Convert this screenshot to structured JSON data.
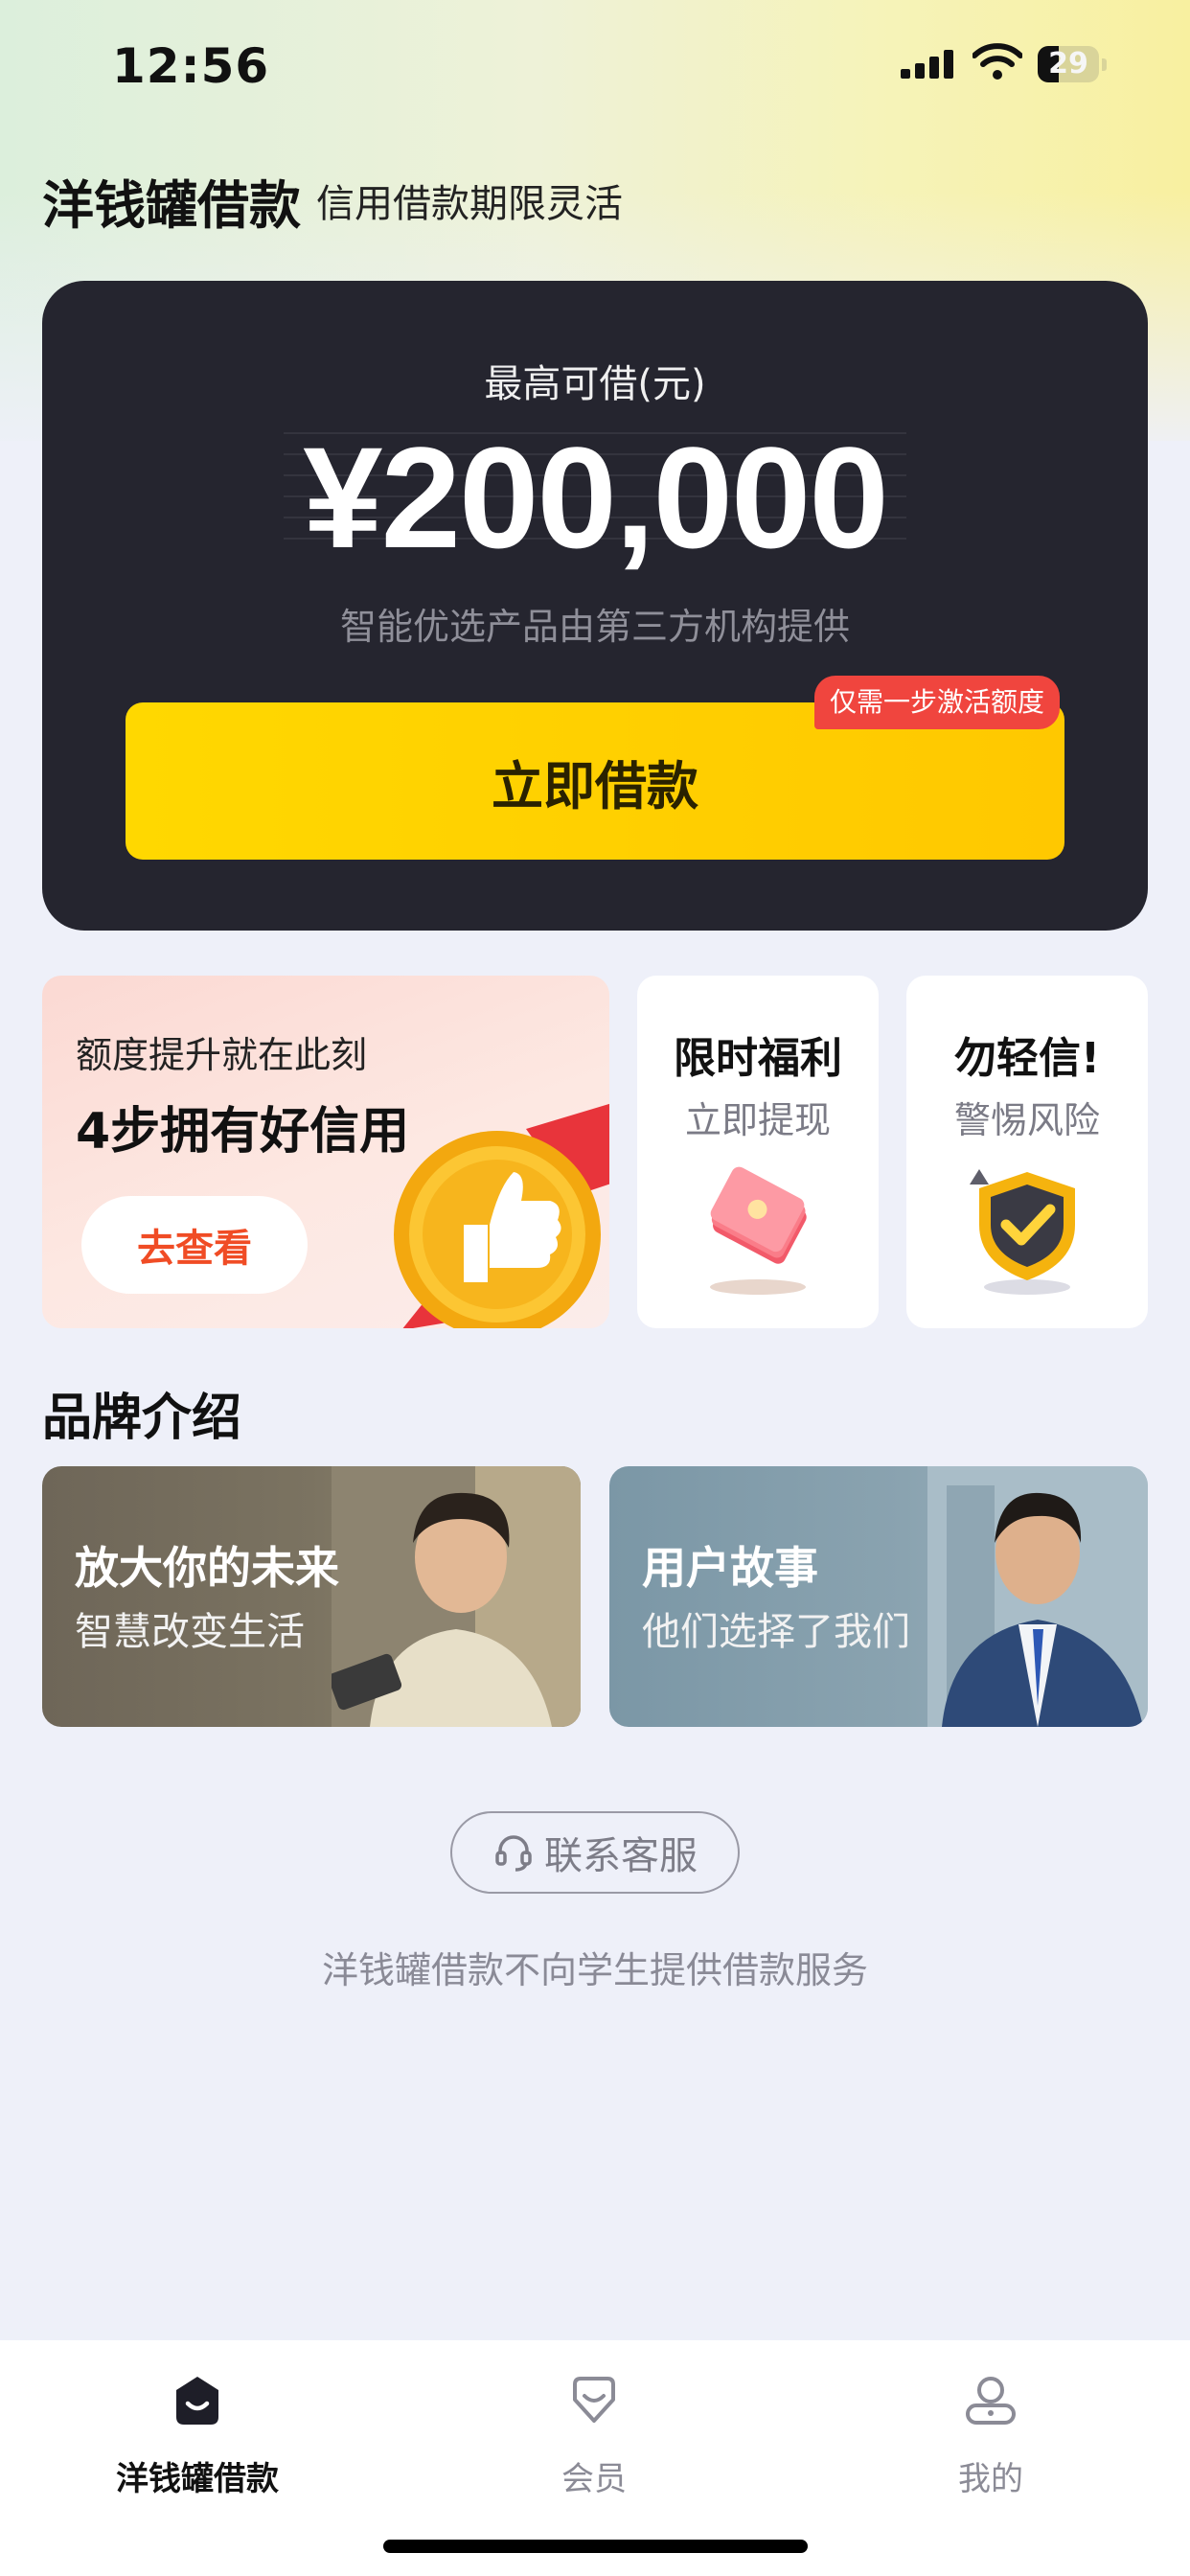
{
  "status_bar": {
    "time": "12:56",
    "battery": "29"
  },
  "header": {
    "title": "洋钱罐借款",
    "subtitle": "信用借款期限灵活"
  },
  "hero": {
    "label": "最高可借(元)",
    "amount": "¥200,000",
    "note": "智能优选产品由第三方机构提供",
    "button_label": "立即借款",
    "badge": "仅需一步激活额度"
  },
  "promo": {
    "small": "额度提升就在此刻",
    "big": "4步拥有好信用",
    "button_label": "去查看"
  },
  "mini_cards": [
    {
      "title": "限时福利",
      "subtitle": "立即提现",
      "icon": "red-envelope-icon"
    },
    {
      "title": "勿轻信!",
      "subtitle": "警惕风险",
      "icon": "shield-check-icon"
    }
  ],
  "brand": {
    "title": "品牌介绍",
    "banners": [
      {
        "title": "放大你的未来",
        "subtitle": "智慧改变生活"
      },
      {
        "title": "用户故事",
        "subtitle": "他们选择了我们"
      }
    ]
  },
  "service": {
    "label": "联系客服",
    "icon": "headset-icon"
  },
  "disclaimer": "洋钱罐借款不向学生提供借款服务",
  "tabs": [
    {
      "label": "洋钱罐借款",
      "icon": "home-smile-icon",
      "active": true
    },
    {
      "label": "会员",
      "icon": "member-icon",
      "active": false
    },
    {
      "label": "我的",
      "icon": "profile-icon",
      "active": false
    }
  ],
  "colors": {
    "accent": "#ffd200",
    "dark_card": "#25252f",
    "badge": "#f0453e",
    "promo_button_text": "#f04c25"
  }
}
